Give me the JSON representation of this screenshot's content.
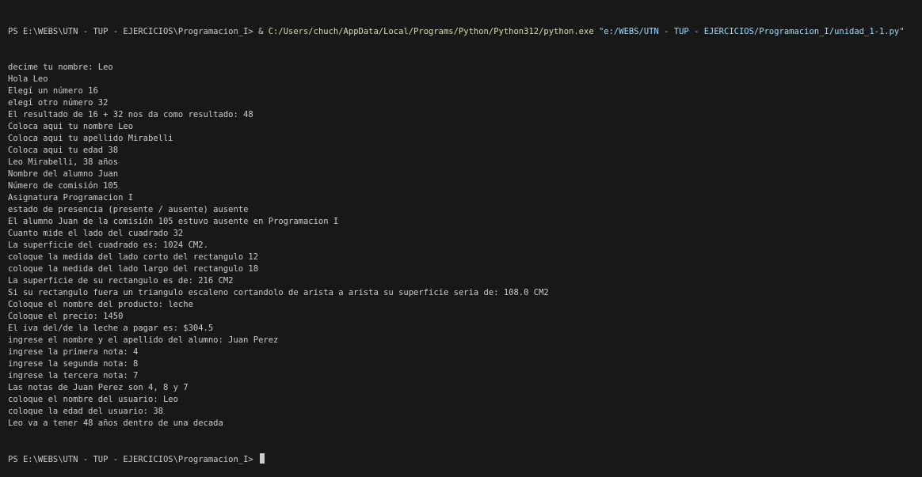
{
  "command": {
    "prompt": "PS E:\\WEBS\\UTN - TUP - EJERCICIOS\\Programacion_I>",
    "operator": " & ",
    "executable": "C:/Users/chuch/AppData/Local/Programs/Python/Python312/python.exe",
    "argument": " \"e:/WEBS/UTN - TUP - EJERCICIOS/Programacion_I/unidad_1-1.py\""
  },
  "output_lines": [
    "decime tu nombre: Leo",
    "Hola Leo",
    "Elegí un número 16",
    "elegí otro número 32",
    "El resultado de 16 + 32 nos da como resultado: 48",
    "Coloca aqui tu nombre Leo",
    "Coloca aqui tu apellido Mirabelli",
    "Coloca aqui tu edad 38",
    "Leo Mirabelli, 38 años",
    "Nombre del alumno Juan",
    "Número de comisión 105",
    "Asignatura Programacion I",
    "estado de presencia (presente / ausente) ausente",
    "El alumno Juan de la comisión 105 estuvo ausente en Programacion I",
    "Cuanto mide el lado del cuadrado 32",
    "La superficie del cuadrado es: 1024 CM2.",
    "coloque la medida del lado corto del rectangulo 12",
    "coloque la medida del lado largo del rectangulo 18",
    "La superficie de su rectangulo es de: 216 CM2",
    "Si su rectangulo fuera un triangulo escaleno cortandolo de arista a arista su superficie seria de: 108.0 CM2",
    "Coloque el nombre del producto: leche",
    "Coloque el precio: 1450",
    "El iva del/de la leche a pagar es: $304.5",
    "ingrese el nombre y el apellido del alumno: Juan Perez",
    "ingrese la primera nota: 4",
    "ingrese la segunda nota: 8",
    "ingrese la tercera nota: 7",
    "Las notas de Juan Perez son 4, 8 y 7",
    "coloque el nombre del usuario: Leo",
    "coloque la edad del usuario: 38",
    "Leo va a tener 48 años dentro de una decada"
  ],
  "final_prompt": "PS E:\\WEBS\\UTN - TUP - EJERCICIOS\\Programacion_I>",
  "colors": {
    "background": "#181818",
    "text": "#cccccc",
    "executable": "#dcdcaa",
    "argument": "#9cdcfe"
  }
}
